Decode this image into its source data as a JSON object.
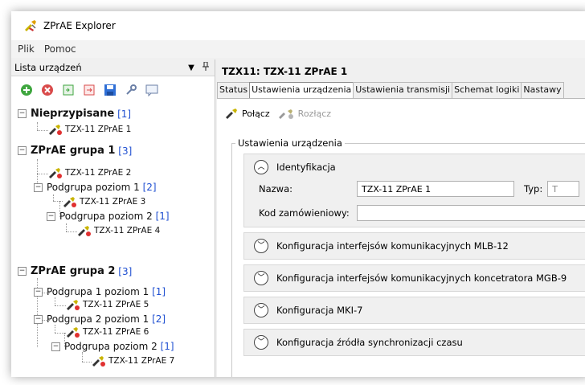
{
  "app": {
    "title": "ZPrAE Explorer"
  },
  "menu": {
    "items": [
      "Plik",
      "Pomoc"
    ]
  },
  "devices_panel": {
    "header": "Lista urządzeń",
    "dropdown_icon": "chevron-down-icon",
    "pin_icon": "pin-icon",
    "toolbar_icons": [
      "add-icon",
      "remove-icon",
      "import-icon",
      "export-icon",
      "save-icon",
      "settings-icon",
      "comment-icon"
    ],
    "tree": {
      "group_unassigned": {
        "label": "Nieprzypisane",
        "count": "[1]",
        "device": "TZX-11 ZPrAE 1"
      },
      "group1": {
        "label": "ZPrAE grupa 1",
        "count": "[3]",
        "device": "TZX-11 ZPrAE 2",
        "sub1": {
          "label": "Podgrupa poziom 1",
          "count": "[2]",
          "device": "TZX-11 ZPrAE 3"
        },
        "sub2": {
          "label": "Podgrupa poziom 2",
          "count": "[1]",
          "device": "TZX-11 ZPrAE 4"
        }
      },
      "group2": {
        "label": "ZPrAE grupa 2",
        "count": "[3]",
        "sub1": {
          "label": "Podgrupa 1 poziom 1",
          "count": "[1]",
          "device": "TZX-11 ZPrAE 5"
        },
        "sub2": {
          "label": "Podgrupa 2 poziom 1",
          "count": "[2]",
          "device": "TZX-11 ZPrAE 6"
        },
        "sub3": {
          "label": "Podgrupa poziom 2",
          "count": "[1]",
          "device": "TZX-11 ZPrAE 7"
        }
      }
    }
  },
  "detail": {
    "title": "TZX11: TZX-11 ZPrAE 1",
    "tabs": [
      "Status",
      "Ustawienia urządzenia",
      "Ustawienia transmisji",
      "Schemat logiki",
      "Nastawy"
    ],
    "actions": {
      "connect": "Połącz",
      "disconnect": "Rozłącz"
    },
    "groupbox_title": "Ustawienia urządzenia",
    "sections": {
      "identification": {
        "title": "Identyfikacja",
        "name_label": "Nazwa:",
        "name_value": "TZX-11 ZPrAE 1",
        "type_label": "Typ:",
        "type_value": "T",
        "order_code_label": "Kod zamówieniowy:",
        "order_code_value": ""
      },
      "mlb": "Konfiguracja interfejsów komunikacyjnych MLB-12",
      "mgb": "Konfiguracja interfejsów komunikacyjnych koncetratora MGB-9",
      "mki": "Konfiguracja MKI-7",
      "sync": "Konfiguracja źródła synchronizacji czasu"
    }
  },
  "colors": {
    "count_link": "#1f4fd1",
    "active_tab": "#ffffff",
    "panel_bg": "#f0f0f0"
  }
}
